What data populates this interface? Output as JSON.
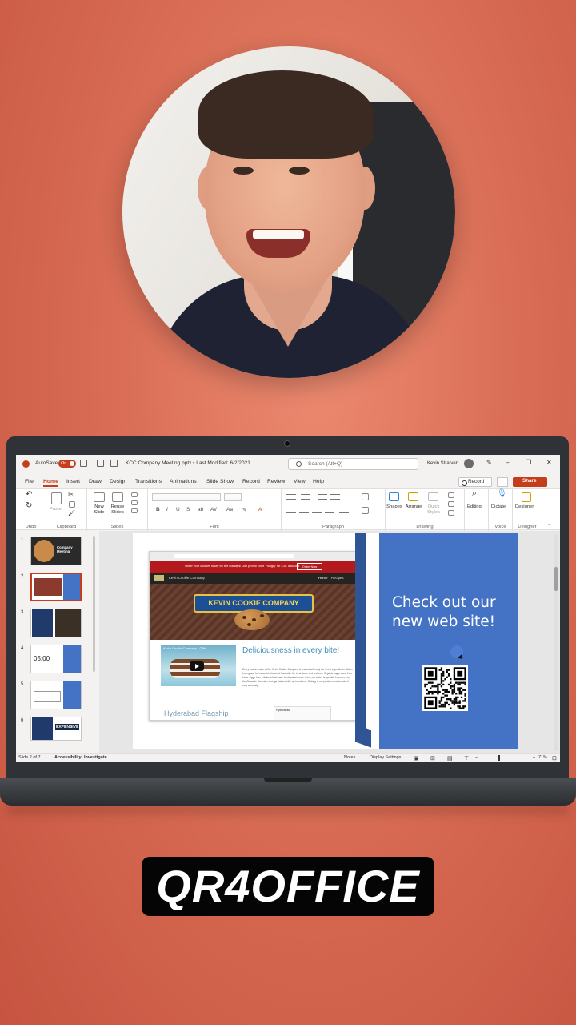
{
  "titlebar": {
    "autosave_label": "AutoSave",
    "autosave_state": "On",
    "document_title": "KCC Company Meeting.pptx • Last Modified: 6/2/2021",
    "search_placeholder": "Search (Alt+Q)",
    "user_name": "Kevin Stratvert"
  },
  "menu": {
    "tabs": [
      "File",
      "Home",
      "Insert",
      "Draw",
      "Design",
      "Transitions",
      "Animations",
      "Slide Show",
      "Record",
      "Review",
      "View",
      "Help"
    ],
    "active_tab": "Home",
    "record_label": "Record",
    "share_label": "Share"
  },
  "ribbon": {
    "groups": {
      "undo": "Undo",
      "clipboard": "Clipboard",
      "slides": "Slides",
      "font": "Font",
      "paragraph": "Paragraph",
      "drawing": "Drawing",
      "voice": "Voice",
      "designer": "Designer"
    },
    "buttons": {
      "paste": "Paste",
      "new_slide": "New Slide",
      "reuse_slides": "Reuse Slides",
      "shapes": "Shapes",
      "arrange": "Arrange",
      "quick_styles": "Quick Styles",
      "editing": "Editing",
      "dictate": "Dictate",
      "designer": "Designer"
    }
  },
  "thumbnails": {
    "numbers": [
      "1",
      "2",
      "3",
      "4",
      "5",
      "6"
    ],
    "slide1_title": "Company Meeting",
    "slide4_time": "05:00",
    "slide6_text": "EXPENSIVE"
  },
  "slide": {
    "website": {
      "promo_text": "Order your cookies today for the holidays! Use promo code 'Hungry' for 4.81 discount",
      "order_button": "Order Now",
      "site_name": "Kevin Cookie Company",
      "nav_home": "Home",
      "nav_recipes": "Recipes",
      "banner": "KEVIN COOKIE COMPANY",
      "video_title": "Kevin Cookie Company - Offici...",
      "headline": "Deliciousness in every bite!",
      "body": "Every cookie made at the Kevin Cookie Company is crafted with only the finest ingredients. Butter from grass fed cows. Unbleached flour with the best flavor and textures. Organic sugar cane from India. Eggs from chickens that listen to classical music. Even our water is special. It comes from the Cascade Mountain springs that we hike up to retrieve. Baking is our passion and we take it very seriously.",
      "location_heading": "Hyderabad Flagship",
      "location_card": "Hyderabad"
    },
    "callout": "Check out our new web site!"
  },
  "statusbar": {
    "slide_count": "Slide 2 of 7",
    "accessibility": "Accessibility: Investigate",
    "notes": "Notes",
    "display_settings": "Display Settings",
    "zoom": "71%"
  },
  "caption": "QR4OFFICE",
  "colors": {
    "background": "#d96d55",
    "ppt_accent": "#c43e1c",
    "callout_blue": "#4472c4",
    "caption_bg": "#050505"
  }
}
